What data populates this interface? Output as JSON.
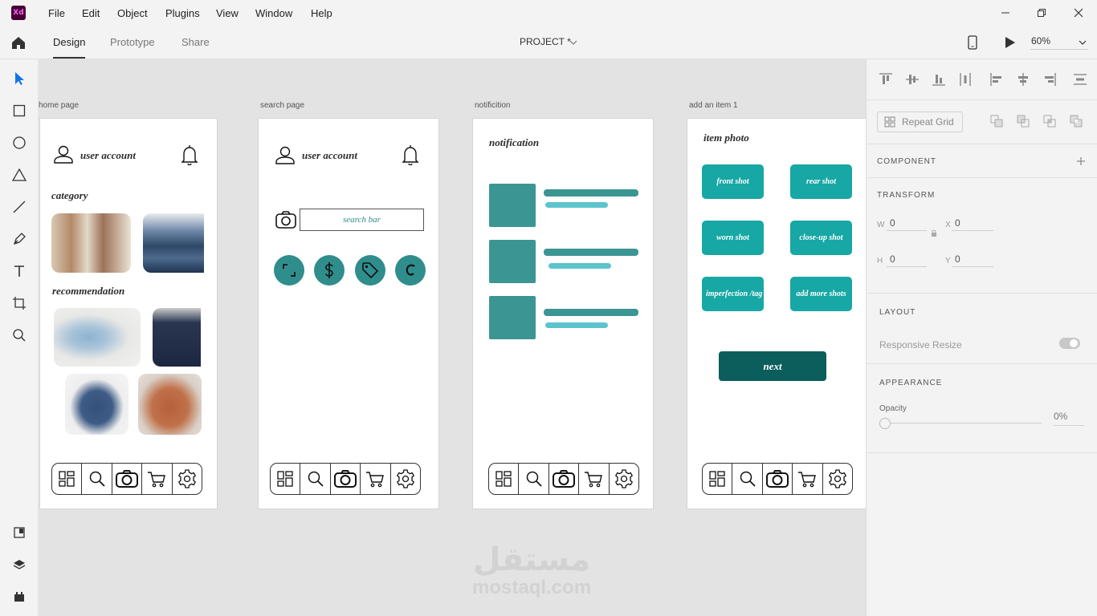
{
  "app": {
    "logo_text": "Xd",
    "accent": "#470137"
  },
  "menu": [
    "File",
    "Edit",
    "Object",
    "Plugins",
    "View",
    "Window",
    "Help"
  ],
  "tabs": {
    "design": "Design",
    "prototype": "Prototype",
    "share": "Share"
  },
  "document": {
    "title": "PROJECT *"
  },
  "zoom": "60%",
  "artboards": {
    "home": {
      "label": "home page",
      "user_account": "user account",
      "category": "category",
      "recommendation": "recommendation"
    },
    "search": {
      "label": "search page",
      "user_account": "user account",
      "search_placeholder": "search bar"
    },
    "notification": {
      "label": "notificition",
      "title": "notification"
    },
    "add_item": {
      "label": "add an item 1",
      "title": "item photo",
      "buttons": [
        "front shot",
        "rear shot",
        "worn shot",
        "close-up shot",
        "imperfection /tag",
        "add more shots"
      ],
      "next": "next"
    }
  },
  "colors": {
    "teal": "#17a7a4",
    "dark_teal": "#0c5e5c",
    "notif_teal": "#3b9593"
  },
  "properties": {
    "repeat_grid": "Repeat Grid",
    "component": "COMPONENT",
    "transform": "TRANSFORM",
    "w_label": "W",
    "w_value": "0",
    "h_label": "H",
    "h_value": "0",
    "x_label": "X",
    "x_value": "0",
    "y_label": "Y",
    "y_value": "0",
    "layout": "LAYOUT",
    "responsive_resize": "Responsive Resize",
    "appearance": "APPEARANCE",
    "opacity_label": "Opacity",
    "opacity_value": "0%"
  },
  "watermark": {
    "arabic": "مستقل",
    "latin": "mostaql.com"
  }
}
